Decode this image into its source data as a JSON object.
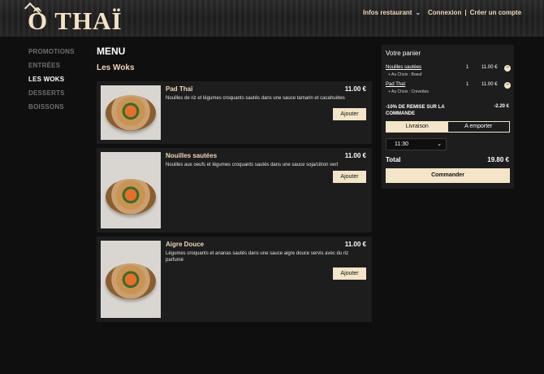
{
  "header": {
    "logo": "Ô THAÏ",
    "nav": {
      "info": "Infos restaurant",
      "login": "Connexion",
      "separator": "|",
      "register": "Créer un compte"
    }
  },
  "sidebar": {
    "items": [
      {
        "label": "PROMOTIONS"
      },
      {
        "label": "ENTRÉES"
      },
      {
        "label": "LES WOKS"
      },
      {
        "label": "DESSERTS"
      },
      {
        "label": "BOISSONS"
      }
    ],
    "active_index": 2
  },
  "main": {
    "title": "MENU",
    "section": "Les Woks",
    "items": [
      {
        "name": "Pad Thaï",
        "price": "11.00 €",
        "desc": "Nouilles de riz et légumes croquants sautés dans une sauce tamarin et cacahuètes",
        "button": "Ajouter"
      },
      {
        "name": "Nouilles sautées",
        "price": "11.00 €",
        "desc": "Nouilles aux oeufs et légumes croquants sautés dans une sauce soja/citron vert",
        "button": "Ajouter"
      },
      {
        "name": "Aigre Douce",
        "price": "11.00 €",
        "desc": "Légumes croquants et ananas sautés dans une sauce aigre douce servis avec du riz parfumé",
        "button": "Ajouter"
      }
    ]
  },
  "cart": {
    "title": "Votre panier",
    "lines": [
      {
        "name": "Nouilles sautées",
        "qty": "1",
        "price": "11.00 €",
        "option": "+ Au Choix : Boeuf"
      },
      {
        "name": "Pad Thaï",
        "qty": "1",
        "price": "11.00 €",
        "option": "+ Au Choix : Crevettes"
      }
    ],
    "discount_label": "-10% DE REMISE SUR LA COMMANDE",
    "discount_amount": "-2.20 €",
    "delivery": "Livraison",
    "takeaway": "A emporter",
    "time": "11:30",
    "total_label": "Total",
    "total_value": "19.80 €",
    "order_button": "Commander"
  },
  "colors": {
    "accent": "#f4e4c8",
    "background": "#0f0f10",
    "card": "#1d1d1e"
  }
}
